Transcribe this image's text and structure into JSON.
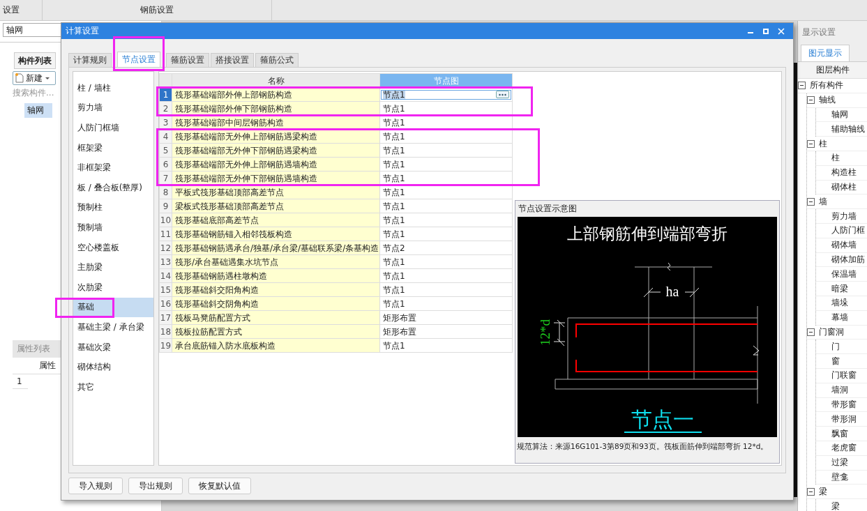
{
  "app": {
    "top_tabs": [
      {
        "label": "设置"
      },
      {
        "label": "钢筋设置"
      }
    ],
    "left_panel": {
      "filter_value": "轴网",
      "list_tab": "构件列表",
      "new_button": "新建",
      "search_placeholder": "搜索构件...",
      "items": [
        {
          "label": "轴网",
          "selected": true
        }
      ],
      "properties_title": "属性列表",
      "properties_header": "属性",
      "properties_rows": [
        "1"
      ]
    },
    "right_panel": {
      "title": "显示设置",
      "tabs": [
        {
          "label": "图元显示",
          "selected": true
        }
      ],
      "tree_header": "图层构件",
      "tree": [
        {
          "label": "所有构件",
          "expanded": true,
          "children": [
            {
              "label": "轴线",
              "expanded": true,
              "children": [
                {
                  "label": "轴网"
                },
                {
                  "label": "辅助轴线"
                }
              ]
            },
            {
              "label": "柱",
              "expanded": true,
              "children": [
                {
                  "label": "柱"
                },
                {
                  "label": "构造柱"
                },
                {
                  "label": "砌体柱"
                }
              ]
            },
            {
              "label": "墙",
              "expanded": true,
              "children": [
                {
                  "label": "剪力墙"
                },
                {
                  "label": "人防门框"
                },
                {
                  "label": "砌体墙"
                },
                {
                  "label": "砌体加筋"
                },
                {
                  "label": "保温墙"
                },
                {
                  "label": "暗梁"
                },
                {
                  "label": "墙垛"
                },
                {
                  "label": "幕墙"
                }
              ]
            },
            {
              "label": "门窗洞",
              "expanded": true,
              "children": [
                {
                  "label": "门"
                },
                {
                  "label": "窗"
                },
                {
                  "label": "门联窗"
                },
                {
                  "label": "墙洞"
                },
                {
                  "label": "带形窗"
                },
                {
                  "label": "带形洞"
                },
                {
                  "label": "飘窗"
                },
                {
                  "label": "老虎窗"
                },
                {
                  "label": "过梁"
                },
                {
                  "label": "壁龛"
                }
              ]
            },
            {
              "label": "梁",
              "expanded": true,
              "children": [
                {
                  "label": "梁"
                }
              ]
            }
          ]
        }
      ]
    }
  },
  "dialog": {
    "title": "计算设置",
    "tabs": [
      {
        "label": "计算规则",
        "selected": false,
        "highlighted": false
      },
      {
        "label": "节点设置",
        "selected": true,
        "highlighted": true
      },
      {
        "label": "箍筋设置",
        "selected": false,
        "highlighted": false
      },
      {
        "label": "搭接设置",
        "selected": false,
        "highlighted": false
      },
      {
        "label": "箍筋公式",
        "selected": false,
        "highlighted": false
      }
    ],
    "categories": [
      {
        "label": "柱 / 墙柱",
        "selected": false,
        "highlighted": false
      },
      {
        "label": "剪力墙",
        "selected": false,
        "highlighted": false
      },
      {
        "label": "人防门框墙",
        "selected": false,
        "highlighted": false
      },
      {
        "label": "框架梁",
        "selected": false,
        "highlighted": false
      },
      {
        "label": "非框架梁",
        "selected": false,
        "highlighted": false
      },
      {
        "label": "板 / 叠合板(整厚)",
        "selected": false,
        "highlighted": false
      },
      {
        "label": "预制柱",
        "selected": false,
        "highlighted": false
      },
      {
        "label": "预制墙",
        "selected": false,
        "highlighted": false
      },
      {
        "label": "空心楼盖板",
        "selected": false,
        "highlighted": false
      },
      {
        "label": "主肋梁",
        "selected": false,
        "highlighted": false
      },
      {
        "label": "次肋梁",
        "selected": false,
        "highlighted": false
      },
      {
        "label": "基础",
        "selected": true,
        "highlighted": true
      },
      {
        "label": "基础主梁 / 承台梁",
        "selected": false,
        "highlighted": false
      },
      {
        "label": "基础次梁",
        "selected": false,
        "highlighted": false
      },
      {
        "label": "砌体结构",
        "selected": false,
        "highlighted": false
      },
      {
        "label": "其它",
        "selected": false,
        "highlighted": false
      }
    ],
    "table": {
      "columns": [
        "名称",
        "节点图"
      ],
      "rows": [
        {
          "index": "1",
          "name": "筏形基础端部外伸上部钢筋构造",
          "node": "节点1",
          "selected": true,
          "highlighted": true
        },
        {
          "index": "2",
          "name": "筏形基础端部外伸下部钢筋构造",
          "node": "节点1",
          "selected": false,
          "highlighted": true
        },
        {
          "index": "3",
          "name": "筏形基础端部中间层钢筋构造",
          "node": "节点1",
          "selected": false,
          "highlighted": false
        },
        {
          "index": "4",
          "name": "筏形基础端部无外伸上部钢筋遇梁构造",
          "node": "节点1",
          "selected": false,
          "highlighted": true
        },
        {
          "index": "5",
          "name": "筏形基础端部无外伸下部钢筋遇梁构造",
          "node": "节点1",
          "selected": false,
          "highlighted": true
        },
        {
          "index": "6",
          "name": "筏形基础端部无外伸上部钢筋遇墙构造",
          "node": "节点1",
          "selected": false,
          "highlighted": true
        },
        {
          "index": "7",
          "name": "筏形基础端部无外伸下部钢筋遇墙构造",
          "node": "节点1",
          "selected": false,
          "highlighted": true
        },
        {
          "index": "8",
          "name": "平板式筏形基础顶部高差节点",
          "node": "节点1",
          "selected": false,
          "highlighted": false
        },
        {
          "index": "9",
          "name": "梁板式筏形基础顶部高差节点",
          "node": "节点1",
          "selected": false,
          "highlighted": false
        },
        {
          "index": "10",
          "name": "筏形基础底部高差节点",
          "node": "节点1",
          "selected": false,
          "highlighted": false
        },
        {
          "index": "11",
          "name": "筏形基础钢筋锚入相邻筏板构造",
          "node": "节点1",
          "selected": false,
          "highlighted": false
        },
        {
          "index": "12",
          "name": "筏形基础钢筋遇承台/独基/承台梁/基础联系梁/条基构造",
          "node": "节点2",
          "selected": false,
          "highlighted": false
        },
        {
          "index": "13",
          "name": "筏形/承台基础遇集水坑节点",
          "node": "节点1",
          "selected": false,
          "highlighted": false
        },
        {
          "index": "14",
          "name": "筏形基础钢筋遇柱墩构造",
          "node": "节点1",
          "selected": false,
          "highlighted": false
        },
        {
          "index": "15",
          "name": "筏形基础斜交阳角构造",
          "node": "节点1",
          "selected": false,
          "highlighted": false
        },
        {
          "index": "16",
          "name": "筏形基础斜交阴角构造",
          "node": "节点1",
          "selected": false,
          "highlighted": false
        },
        {
          "index": "17",
          "name": "筏板马凳筋配置方式",
          "node": "矩形布置",
          "selected": false,
          "highlighted": false
        },
        {
          "index": "18",
          "name": "筏板拉筋配置方式",
          "node": "矩形布置",
          "selected": false,
          "highlighted": false
        },
        {
          "index": "19",
          "name": "承台底筋锚入防水底板构造",
          "node": "节点1",
          "selected": false,
          "highlighted": false
        }
      ]
    },
    "preview": {
      "title": "节点设置示意图",
      "diagram_title": "上部钢筋伸到端部弯折",
      "dimension_width": "ha",
      "dimension_bend": "12*d",
      "node_label": "节点一",
      "note": "规范算法：来源16G101-3第89页和93页。筏板面筋伸到端部弯折 12*d。"
    },
    "buttons": [
      "导入规则",
      "导出规则",
      "恢复默认值"
    ]
  }
}
